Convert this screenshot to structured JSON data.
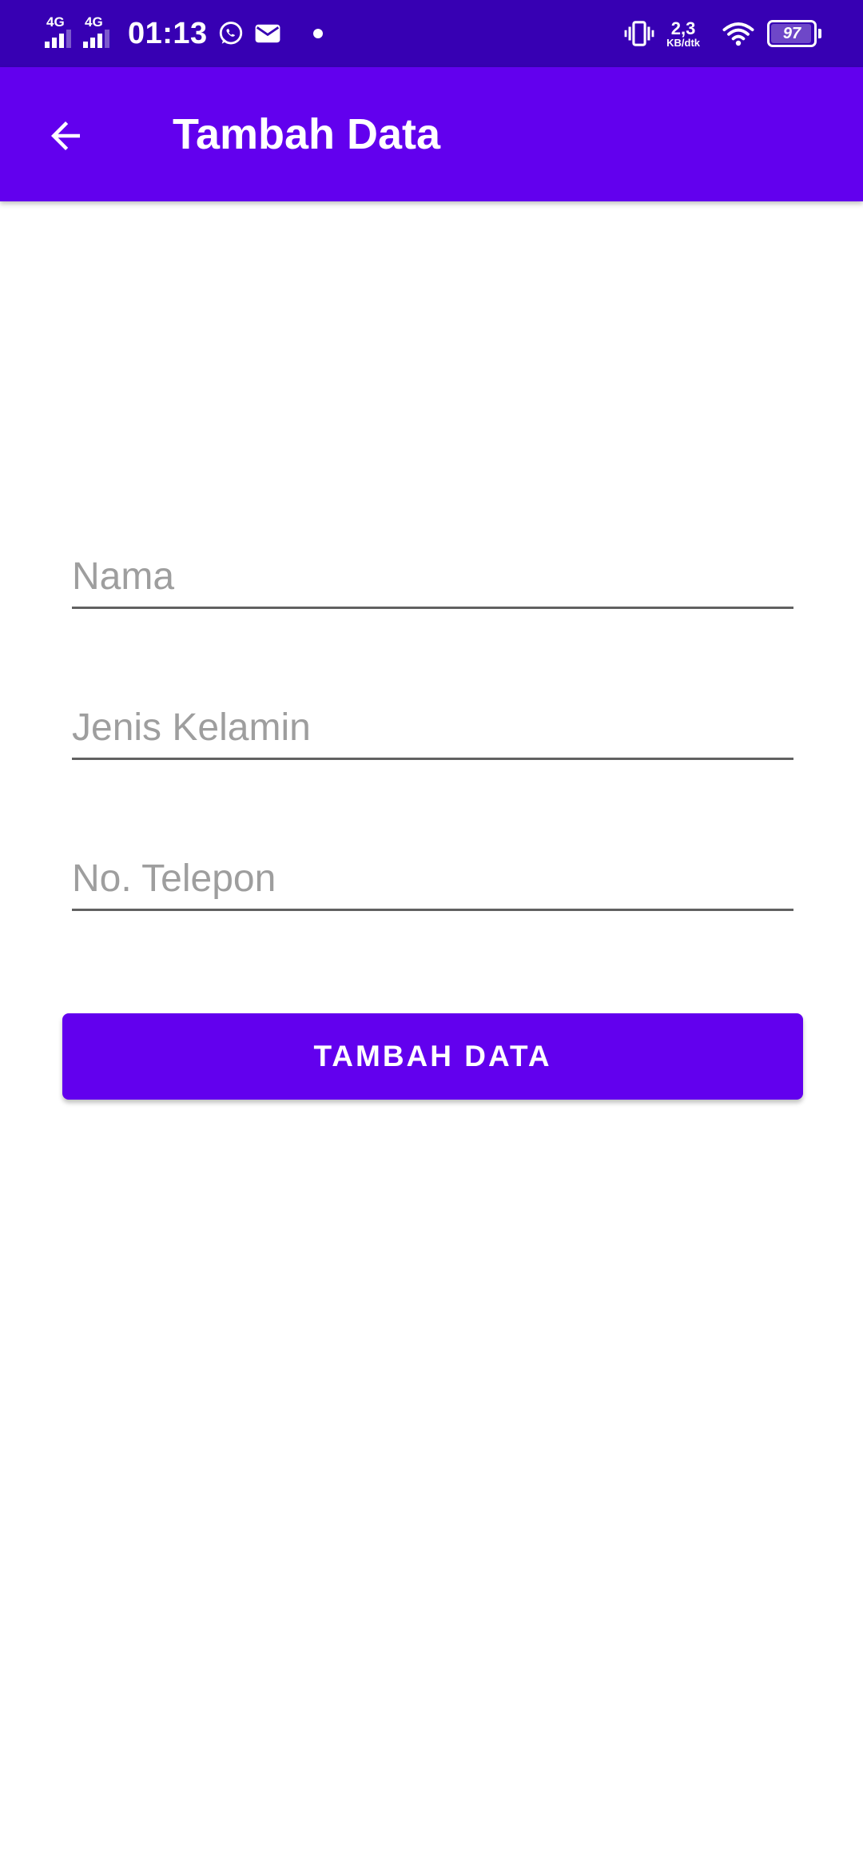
{
  "status_bar": {
    "network_1": "4G",
    "network_2": "4G",
    "time": "01:13",
    "speed_value": "2,3",
    "speed_unit": "KB/dtk",
    "battery_level": "97",
    "icons": [
      "whatsapp-icon",
      "mail-icon",
      "notification-dot-icon",
      "vibrate-icon",
      "wifi-icon",
      "battery-icon"
    ]
  },
  "app_bar": {
    "title": "Tambah Data",
    "background": "#6200ee"
  },
  "form": {
    "fields": [
      {
        "placeholder": "Nama",
        "value": ""
      },
      {
        "placeholder": "Jenis Kelamin",
        "value": ""
      },
      {
        "placeholder": "No. Telepon",
        "value": ""
      }
    ],
    "submit_label": "TAMBAH DATA"
  },
  "colors": {
    "status_bar": "#3700b3",
    "primary": "#6200ee",
    "underline": "#616161",
    "hint": "#9e9e9e"
  }
}
